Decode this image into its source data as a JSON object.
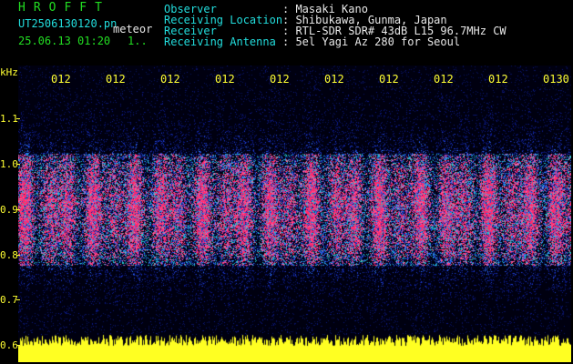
{
  "header": {
    "logo": "HROFFT",
    "filename": "UT2506130120.pn",
    "mode": "meteor",
    "datetime": "25.06.13 01:20",
    "frame": "1..",
    "fields": [
      {
        "label": "Observer",
        "value": ": Masaki Kano"
      },
      {
        "label": "Receiving Location",
        "value": ": Shibukawa, Gunma, Japan"
      },
      {
        "label": "Receiver",
        "value": ": RTL-SDR SDR# 43dB L15 96.7MHz CW"
      },
      {
        "label": "Receiving Antenna",
        "value": ": 5el Yagi Az 280 for Seoul"
      }
    ]
  },
  "axis": {
    "unit": "kHz",
    "y_ticks": [
      "1.1",
      "1.0",
      "0.9",
      "0.8",
      "0.7",
      "0.6"
    ],
    "x_ticks": [
      "012",
      "012",
      "012",
      "012",
      "012",
      "012",
      "012",
      "012",
      "012",
      "0130"
    ]
  },
  "colors": {
    "background": "#000000",
    "label_green": "#22dd22",
    "label_cyan": "#22dddd",
    "value_white": "#e8e8e8",
    "axis_yellow": "#ffff33",
    "signal_magenta": "#ff2a6d"
  }
}
